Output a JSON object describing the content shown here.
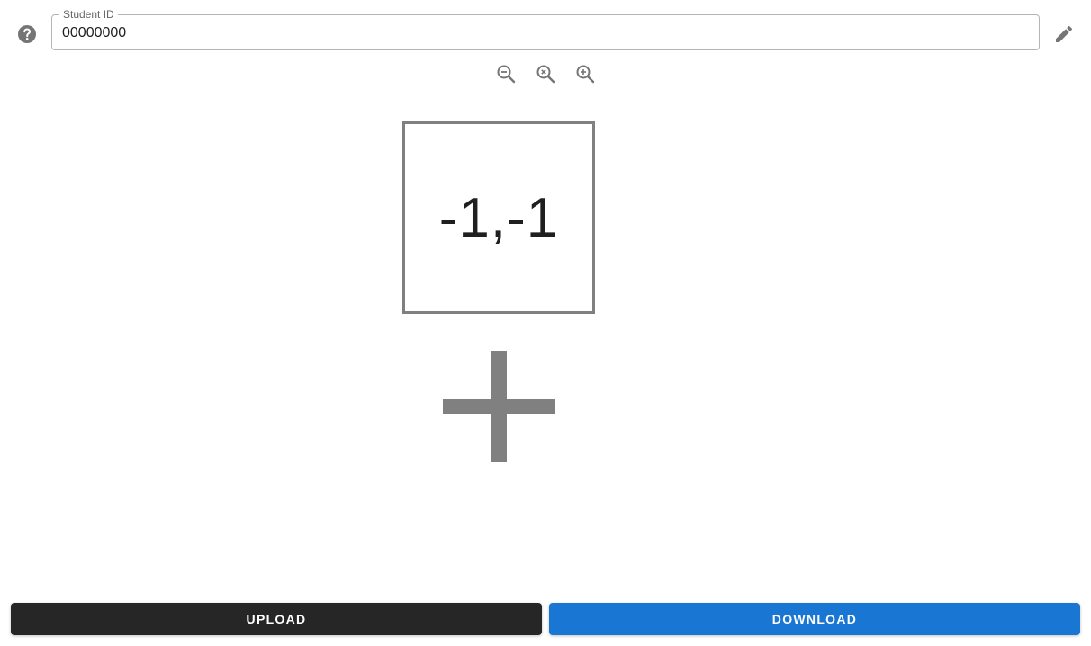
{
  "student_id": {
    "label": "Student ID",
    "value": "00000000"
  },
  "icons": {
    "help": "help-circle-icon",
    "edit": "pencil-icon",
    "zoom_out": "zoom-out-icon",
    "zoom_reset": "zoom-reset-icon",
    "zoom_in": "zoom-in-icon",
    "add": "plus-icon"
  },
  "canvas": {
    "cell_text": "-1,-1"
  },
  "actions": {
    "upload_label": "UPLOAD",
    "download_label": "DOWNLOAD"
  },
  "colors": {
    "icon": "#757575",
    "cell_border": "#808080",
    "upload_bg": "#262626",
    "download_bg": "#1976d2"
  }
}
